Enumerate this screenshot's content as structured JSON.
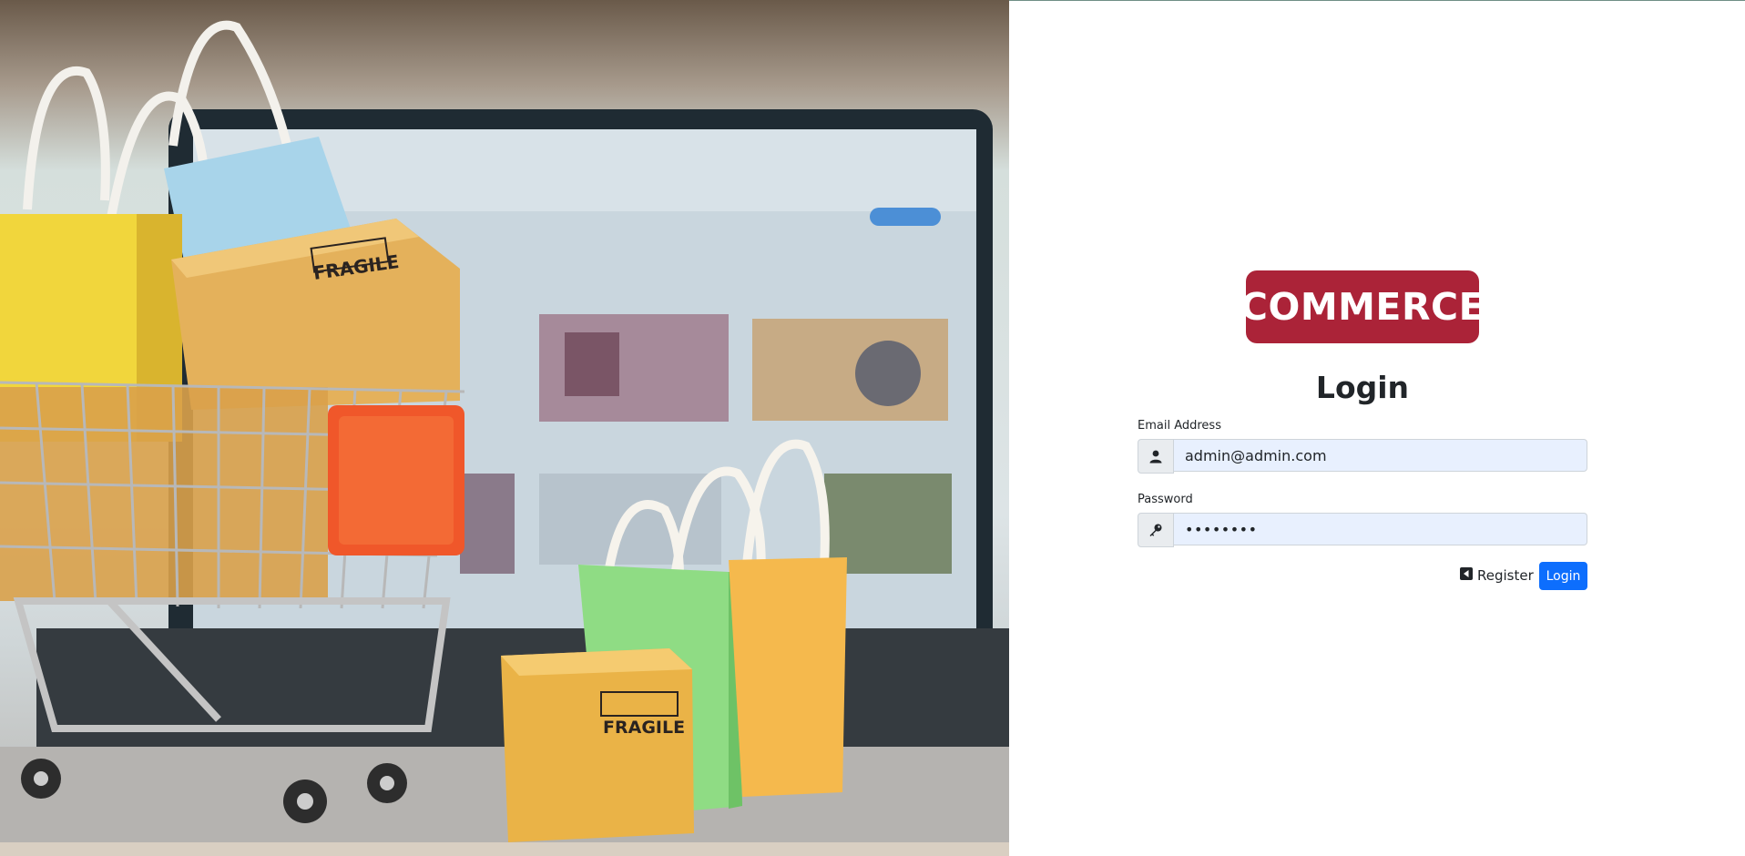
{
  "hero": {
    "box_text_1": "FRAGILE",
    "box_text_2": "FRAGILE"
  },
  "brand": {
    "logo_text": "COMMERCE",
    "color": "#ab2338"
  },
  "login_form": {
    "title": "Login",
    "email_label": "Email Address",
    "email_value": "admin@admin.com",
    "email_icon": "user-icon",
    "password_label": "Password",
    "password_value": "password",
    "password_icon": "key-icon",
    "register_label": "Register",
    "register_icon": "caret-left-square-icon",
    "login_label": "Login",
    "accent_color": "#0d6efd"
  }
}
